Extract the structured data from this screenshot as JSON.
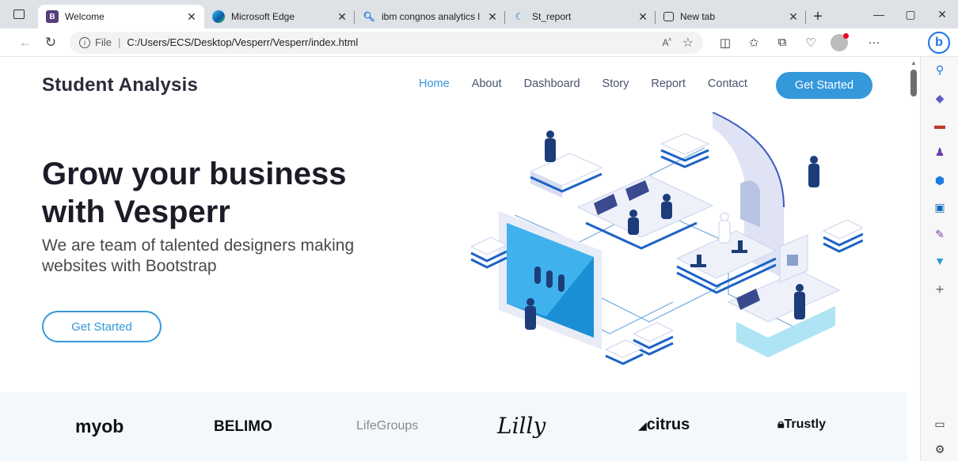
{
  "browser": {
    "tabs": [
      {
        "title": "Welcome",
        "favicon": "B",
        "fav_color": "#563d7c",
        "active": true
      },
      {
        "title": "Microsoft Edge",
        "favicon": "e",
        "fav_color": "#0f7bd3",
        "active": false
      },
      {
        "title": "ibm congnos analytics log",
        "favicon": "q",
        "fav_color": "#ffffff",
        "active": false
      },
      {
        "title": "St_report",
        "favicon": "s",
        "fav_color": "#ffffff",
        "active": false
      },
      {
        "title": "New tab",
        "favicon": "n",
        "fav_color": "#ffffff",
        "active": false
      }
    ],
    "address": {
      "prefix": "File",
      "url": "C:/Users/ECS/Desktop/Vesperr/Vesperr/index.html"
    }
  },
  "site": {
    "brand": "Student Analysis",
    "nav": [
      {
        "label": "Home",
        "active": true
      },
      {
        "label": "About",
        "active": false
      },
      {
        "label": "Dashboard",
        "active": false
      },
      {
        "label": "Story",
        "active": false
      },
      {
        "label": "Report",
        "active": false
      },
      {
        "label": "Contact",
        "active": false
      }
    ],
    "nav_cta": "Get Started",
    "hero": {
      "title": "Grow your business with Vesperr",
      "subtitle": "We are team of talented designers making websites with Bootstrap",
      "cta": "Get Started"
    },
    "clients": [
      "myob",
      "BELIMO",
      "LifeGroups",
      "Lilly",
      "citrus",
      "Trustly"
    ]
  },
  "colors": {
    "accent": "#3498db",
    "brand_text": "#2b2b3a",
    "client_strip": "#f3f8fc"
  }
}
